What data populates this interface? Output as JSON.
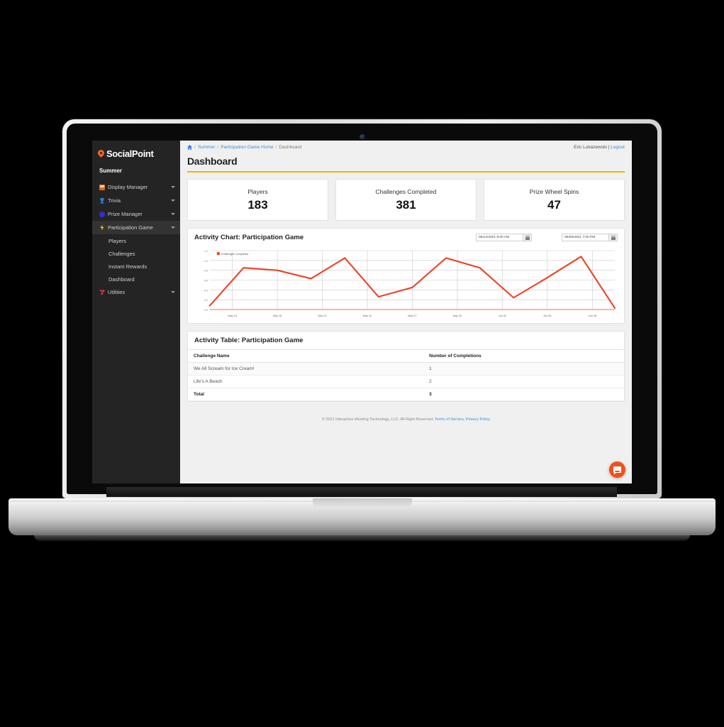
{
  "sidebar": {
    "brand": "SocialPoint",
    "brand_icon": "map-pin-icon",
    "event_name": "Summer",
    "items": [
      {
        "label": "Display Manager",
        "icon": "display-icon",
        "active": false
      },
      {
        "label": "Trivia",
        "icon": "trophy-icon",
        "active": false
      },
      {
        "label": "Prize Manager",
        "icon": "circle-icon",
        "active": false
      },
      {
        "label": "Participation Game",
        "icon": "bolt-icon",
        "active": true
      },
      {
        "label": "Utilities",
        "icon": "wrench-icon",
        "active": false
      }
    ],
    "sub_items": [
      "Players",
      "Challenges",
      "Instant Rewards",
      "Dashboard"
    ]
  },
  "breadcrumb": {
    "home_icon": "home-icon",
    "items": [
      "Summer",
      "Participation Game Home",
      "Dashboard"
    ],
    "separator": "/"
  },
  "user": {
    "name": "Eric Lukazewski",
    "divider": "|",
    "logout": "Logout"
  },
  "header": {
    "title": "Dashboard"
  },
  "stats": [
    {
      "label": "Players",
      "value": "183"
    },
    {
      "label": "Challenges Completed",
      "value": "381"
    },
    {
      "label": "Prize Wheel Spins",
      "value": "47"
    }
  ],
  "chart_panel": {
    "title": "Activity Chart: Participation Game",
    "start_date": "05/12/2021 9:00 AM",
    "end_date": "06/09/2021 7:00 PM",
    "calendar_icon": "calendar-icon"
  },
  "chart_data": {
    "type": "line",
    "title": "Activity Chart: Participation Game",
    "xlabel": "",
    "ylabel": "",
    "ylim": [
      0.0,
      1.2
    ],
    "yticks": [
      "0.0",
      "0.2",
      "0.4",
      "0.6",
      "0.8",
      "1.0",
      "1.2"
    ],
    "xticks": [
      "May 15",
      "May 18",
      "May 21",
      "May 24",
      "May 27",
      "May 30",
      "Jun 02",
      "Jun 05",
      "Jun 08"
    ],
    "grid": true,
    "legend": {
      "position": "top-left",
      "entries": [
        "Challenges Completed"
      ]
    },
    "series": [
      {
        "name": "Challenges Completed",
        "color": "#ef4123",
        "x": [
          "May 14",
          "May 15",
          "May 16",
          "May 18",
          "May 21",
          "May 24",
          "May 27",
          "May 30",
          "Jun 02",
          "Jun 05",
          "Jun 07",
          "Jun 08",
          "Jun 09"
        ],
        "values": [
          0.08,
          0.85,
          0.8,
          0.63,
          1.05,
          0.26,
          0.45,
          1.05,
          0.85,
          0.24,
          0.65,
          1.08,
          0.03
        ]
      }
    ]
  },
  "table_panel": {
    "title": "Activity Table: Participation Game",
    "columns": [
      "Challenge Name",
      "Number of Completions"
    ],
    "rows": [
      {
        "name": "We All Scream for Ice Cream!",
        "count": "1"
      },
      {
        "name": "Life's A Beach",
        "count": "2"
      },
      {
        "name": "Total",
        "count": "3"
      }
    ]
  },
  "footer": {
    "copyright": "© 2021 Interactive Meeting Technology, LLC. All Right Reserved.",
    "terms": "Terms of Service,",
    "privacy": "Privacy Policy"
  },
  "chat": {
    "icon": "chat-bubble-icon"
  },
  "colors": {
    "accent": "#e8b800",
    "brand": "#f26722",
    "chart_line": "#ef4123",
    "sidebar": "#242424"
  }
}
